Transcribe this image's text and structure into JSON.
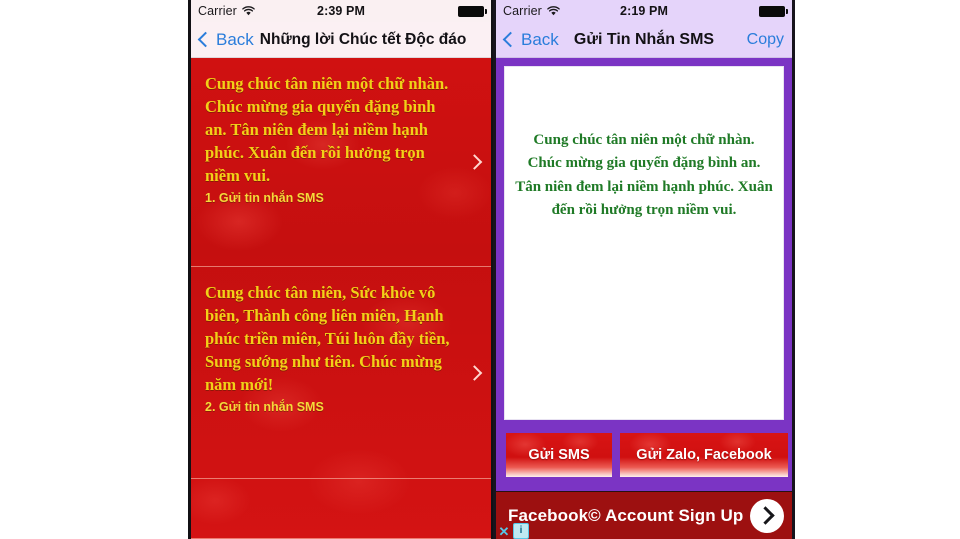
{
  "left_phone": {
    "status_bar": {
      "carrier": "Carrier",
      "wifi_icon": "wifi-icon",
      "time": "2:39 PM",
      "battery_icon": "battery-full-icon"
    },
    "nav": {
      "back_label": "Back",
      "back_icon": "chevron-left-icon",
      "title": "Những lời Chúc tết Độc đáo"
    },
    "rows": [
      {
        "message": "Cung chúc tân niên một chữ nhàn. Chúc mừng gia quyến đặng bình an. Tân niên đem lại niềm hạnh phúc. Xuân đến rồi hưởng trọn niềm vui.",
        "subtitle": "1. Gửi tin nhắn SMS",
        "chevron_icon": "chevron-right-icon"
      },
      {
        "message": "Cung chúc tân niên, Sức khỏe vô biên, Thành công liên miên, Hạnh phúc triền miên, Túi luôn đầy tiền, Sung sướng như tiên. Chúc mừng năm mới!",
        "subtitle": "2. Gửi tin nhắn SMS",
        "chevron_icon": "chevron-right-icon"
      },
      {
        "message": "",
        "subtitle": "",
        "chevron_icon": "chevron-right-icon"
      }
    ]
  },
  "right_phone": {
    "status_bar": {
      "carrier": "Carrier",
      "wifi_icon": "wifi-icon",
      "time": "2:19 PM",
      "battery_icon": "battery-full-icon"
    },
    "nav": {
      "back_label": "Back",
      "back_icon": "chevron-left-icon",
      "title": "Gửi Tin Nhắn SMS",
      "action_label": "Copy"
    },
    "compose": {
      "text": "Cung chúc tân niên một chữ nhàn. Chúc mừng gia quyến đặng bình an. Tân niên đem lại niềm hạnh phúc. Xuân đến rồi hưởng trọn niềm vui.",
      "placeholder": ""
    },
    "buttons": {
      "sms_label": "Gửi SMS",
      "zalo_label": "Gửi Zalo, Facebook"
    },
    "ad": {
      "text": "Facebook© Account Sign Up",
      "arrow_icon": "chevron-right-circle-icon",
      "close_label": "✕",
      "info_label": "i"
    }
  },
  "colors": {
    "red_background": "#c50f0f",
    "gold_text": "#f2d018",
    "purple_frame": "#7b34c4",
    "green_text": "#1f7a26",
    "ios_blue": "#2a7ddb",
    "status_left_bg": "#faf0f2",
    "status_right_bg": "#e5d4fa",
    "ad_red": "#9d1010"
  }
}
